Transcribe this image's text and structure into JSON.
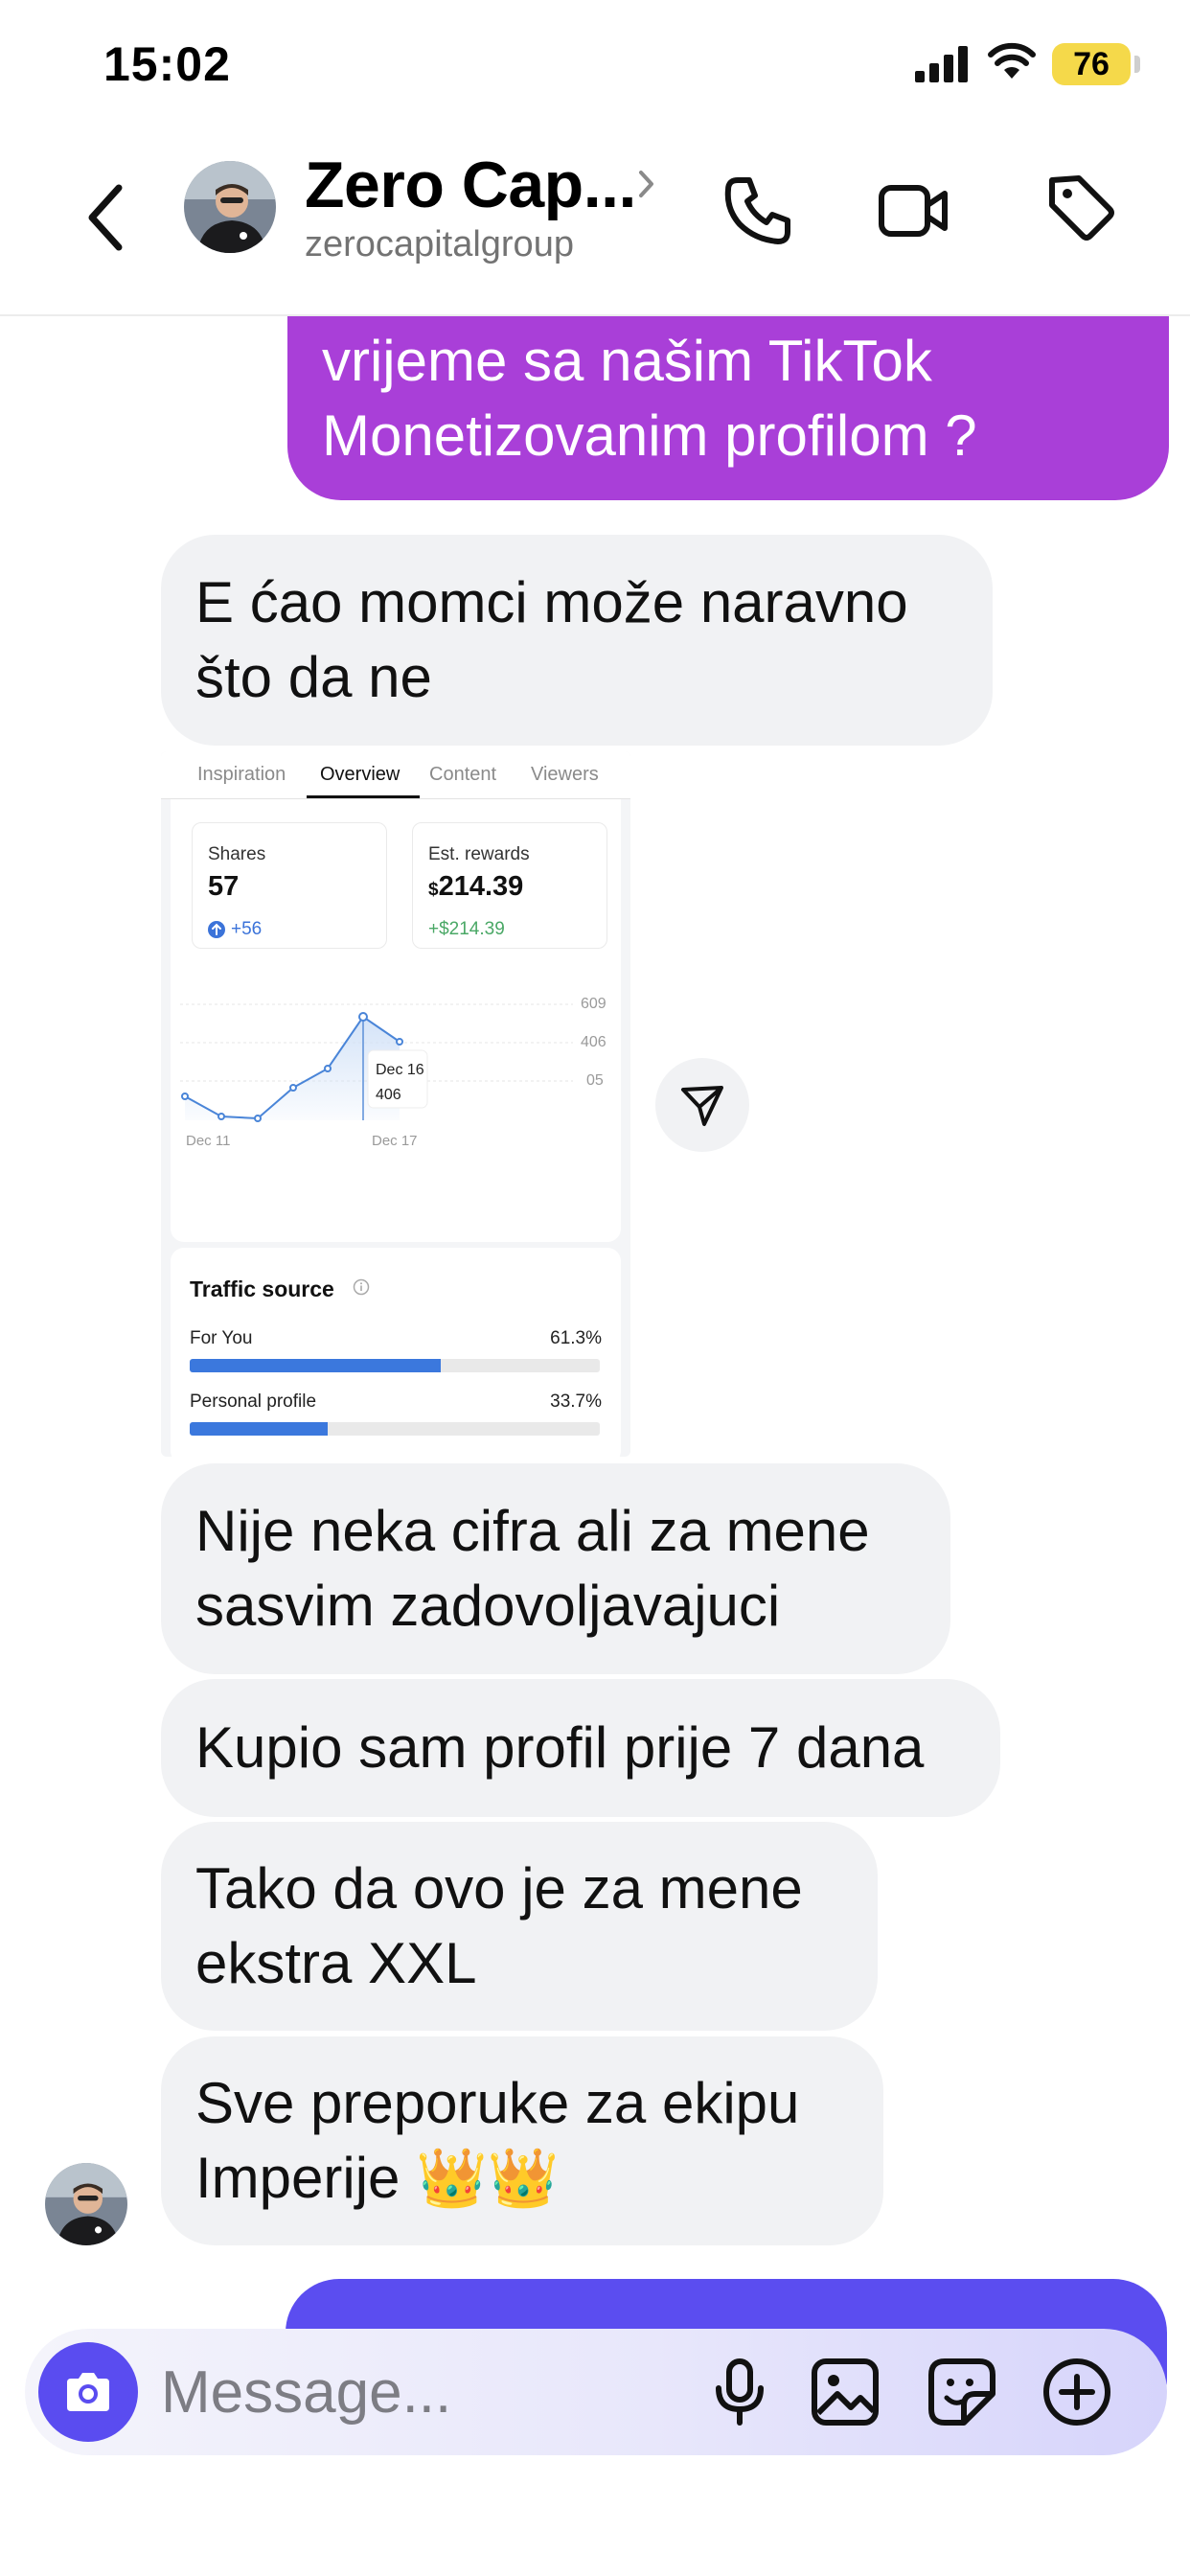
{
  "status_bar": {
    "time": "15:02",
    "battery": "76"
  },
  "header": {
    "contact_name": "Zero Cap...",
    "contact_handle": "zerocapitalgroup"
  },
  "messages": {
    "out_1": {
      "line_1": "vrijeme sa našim TikTok",
      "line_2": "Monetizovanim profilom ?"
    },
    "in_1": {
      "line_1": "E ćao momci može naravno",
      "line_2": "što da ne"
    },
    "in_2": {
      "line_1": "Nije neka cifra ali za mene",
      "line_2": "sasvim zadovoljavajuci"
    },
    "in_3": {
      "line_1": "Kupio sam profil prije 7 dana"
    },
    "in_4": {
      "line_1": "Tako da ovo je za mene",
      "line_2": "ekstra XXL"
    },
    "in_5": {
      "line_1": "Sve preporuke za ekipu",
      "line_2": "Imperije 👑👑"
    }
  },
  "screenshot": {
    "tabs": [
      "Inspiration",
      "Overview",
      "Content",
      "Viewers"
    ],
    "active_tab": "Overview",
    "shares": {
      "label": "Shares",
      "value": "57",
      "delta": "+56"
    },
    "rewards": {
      "label": "Est. rewards",
      "currency": "$",
      "value": "214.39",
      "delta": "+$214.39"
    },
    "chart": {
      "y_ticks": [
        "609",
        "406",
        "05"
      ],
      "x_start": "Dec 11",
      "x_end": "Dec 17",
      "tooltip_date": "Dec 16",
      "tooltip_value": "406"
    },
    "traffic": {
      "title": "Traffic source",
      "sources": [
        {
          "label": "For You",
          "value": "61.3%",
          "fraction": 0.613
        },
        {
          "label": "Personal profile",
          "value": "33.7%",
          "fraction": 0.337
        }
      ]
    }
  },
  "composer": {
    "placeholder": "Message..."
  },
  "colors": {
    "outgoing_bubble_1": "#a93fd8",
    "outgoing_bubble_2": "#5b4df0",
    "incoming_bubble": "#f1f2f4",
    "camera_button": "#5a4cf0",
    "battery": "#f5d94a"
  },
  "icons": {
    "status": [
      "signal-icon",
      "wifi-icon"
    ],
    "header": [
      "back-icon",
      "chevron-right-icon",
      "phone-icon",
      "video-icon",
      "tag-icon"
    ],
    "composer": [
      "camera-icon",
      "microphone-icon",
      "image-icon",
      "sticker-icon",
      "plus-icon"
    ],
    "attachment": [
      "send-icon"
    ]
  }
}
